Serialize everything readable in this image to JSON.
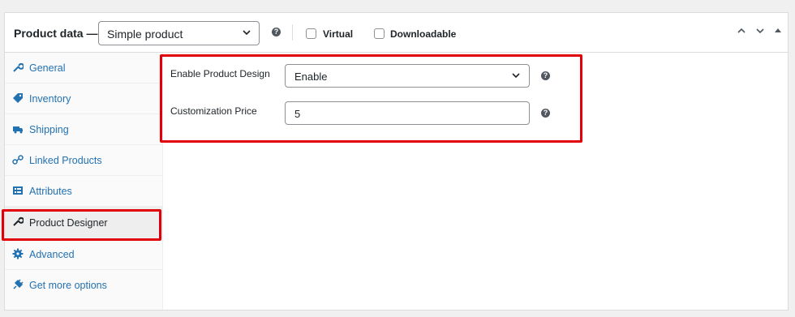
{
  "header": {
    "title": "Product data —",
    "product_type": "Simple product",
    "virtual_label": "Virtual",
    "downloadable_label": "Downloadable"
  },
  "sidebar": {
    "items": [
      {
        "label": "General",
        "icon": "wrench-icon"
      },
      {
        "label": "Inventory",
        "icon": "tag-icon"
      },
      {
        "label": "Shipping",
        "icon": "truck-icon"
      },
      {
        "label": "Linked Products",
        "icon": "link-icon"
      },
      {
        "label": "Attributes",
        "icon": "list-icon"
      },
      {
        "label": "Product Designer",
        "icon": "wrench-icon",
        "active": true
      },
      {
        "label": "Advanced",
        "icon": "gear-icon"
      },
      {
        "label": "Get more options",
        "icon": "plugin-icon"
      }
    ]
  },
  "fields": {
    "enable_design": {
      "label": "Enable Product Design",
      "value": "Enable"
    },
    "customization_price": {
      "label": "Customization Price",
      "value": "5"
    }
  },
  "colors": {
    "accent": "#2271b1",
    "highlight": "#e1000a"
  }
}
